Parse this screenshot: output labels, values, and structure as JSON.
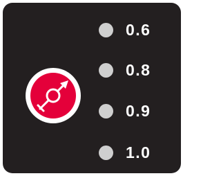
{
  "control": {
    "icon": "flow-control-icon",
    "colors": {
      "panel": "#231f20",
      "dial": "#e4003a",
      "ring": "#ffffff",
      "indicator_off": "#cfcfcf",
      "text": "#ffffff"
    }
  },
  "options": [
    {
      "label": "0.6"
    },
    {
      "label": "0.8"
    },
    {
      "label": "0.9"
    },
    {
      "label": "1.0"
    }
  ]
}
